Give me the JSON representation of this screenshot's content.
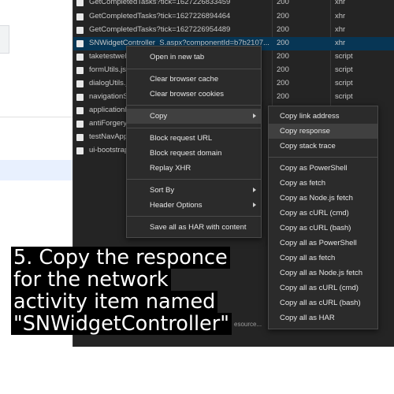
{
  "network": {
    "rows": [
      {
        "name": "GetCompletedTasks?tick=1627226833459",
        "status": "200",
        "type": "xhr"
      },
      {
        "name": "GetCompletedTasks?tick=1627226894464",
        "status": "200",
        "type": "xhr"
      },
      {
        "name": "GetCompletedTasks?tick=1627226954489",
        "status": "200",
        "type": "xhr"
      },
      {
        "name": "SNWidgetController_S.aspx?componentId=b7b2107...",
        "status": "200",
        "type": "xhr"
      },
      {
        "name": "taketestweb",
        "status": "200",
        "type": "script"
      },
      {
        "name": "formUtils.js?",
        "status": "200",
        "type": "script"
      },
      {
        "name": "dialogUtils.js",
        "status": "200",
        "type": "script"
      },
      {
        "name": "navigationS",
        "status": "200",
        "type": "script"
      },
      {
        "name": "applicationI",
        "status": "",
        "type": ""
      },
      {
        "name": "antiForgery",
        "status": "",
        "type": ""
      },
      {
        "name": "testNavApp",
        "status": "",
        "type": ""
      },
      {
        "name": "ui-bootstrap",
        "status": "",
        "type": ""
      }
    ],
    "bottom_fragment": "esource..."
  },
  "context_menu": {
    "open_in_new_tab": "Open in new tab",
    "clear_browser_cache": "Clear browser cache",
    "clear_browser_cookies": "Clear browser cookies",
    "copy": "Copy",
    "block_request_url": "Block request URL",
    "block_request_domain": "Block request domain",
    "replay_xhr": "Replay XHR",
    "sort_by": "Sort By",
    "header_options": "Header Options",
    "save_all_as_har": "Save all as HAR with content"
  },
  "copy_submenu": [
    "Copy link address",
    "Copy response",
    "Copy stack trace",
    "Copy as PowerShell",
    "Copy as fetch",
    "Copy as Node.js fetch",
    "Copy as cURL (cmd)",
    "Copy as cURL (bash)",
    "Copy all as PowerShell",
    "Copy all as fetch",
    "Copy all as Node.js fetch",
    "Copy all as cURL (cmd)",
    "Copy all as cURL (bash)",
    "Copy all as HAR"
  ],
  "caption": {
    "line1": "5. Copy the responce",
    "line2": "for the network",
    "line3": "activity item named",
    "line4": "\"SNWidgetController\""
  },
  "colors": {
    "devtools_bg": "#242424",
    "selected_row": "#073655",
    "menu_bg": "#2b2b2b",
    "menu_highlight": "#404040"
  }
}
